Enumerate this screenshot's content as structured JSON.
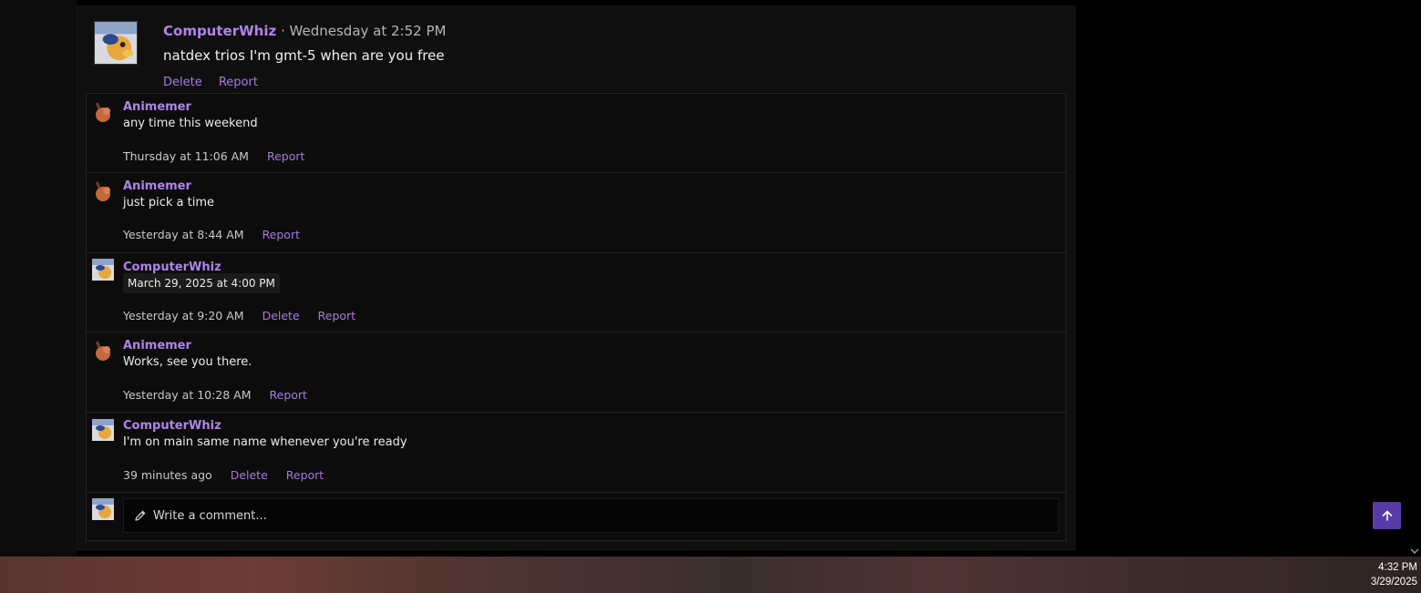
{
  "post": {
    "username": "ComputerWhiz",
    "separator": "·",
    "timestamp": "Wednesday at 2:52 PM",
    "text": "natdex trios I'm gmt-5 when are you free",
    "actions": [
      "Delete",
      "Report"
    ]
  },
  "replies": [
    {
      "username": "Animemer",
      "text": "any time this weekend",
      "timestamp": "Thursday at 11:06 AM",
      "actions": [
        "Report"
      ]
    },
    {
      "username": "Animemer",
      "text": "just pick a time",
      "timestamp": "Yesterday at 8:44 AM",
      "actions": [
        "Report"
      ]
    },
    {
      "username": "ComputerWhiz",
      "text": "March 29, 2025 at 4:00 PM",
      "timestamp": "Yesterday at 9:20 AM",
      "actions": [
        "Delete",
        "Report"
      ]
    },
    {
      "username": "Animemer",
      "text": "Works, see you there.",
      "timestamp": "Yesterday at 10:28 AM",
      "actions": [
        "Report"
      ]
    },
    {
      "username": "ComputerWhiz",
      "text": "I'm on main same name whenever you're ready",
      "timestamp": "39 minutes ago",
      "actions": [
        "Delete",
        "Report"
      ]
    }
  ],
  "composer": {
    "placeholder": "Write a comment...",
    "icon": "pencil-icon"
  },
  "scroll_top_icon": "arrow-up-icon",
  "taskbar": {
    "time": "4:32 PM",
    "date": "3/29/2025"
  },
  "colors": {
    "accent": "#b084ea",
    "link": "#a47ce0",
    "button": "#5a3aa8"
  }
}
